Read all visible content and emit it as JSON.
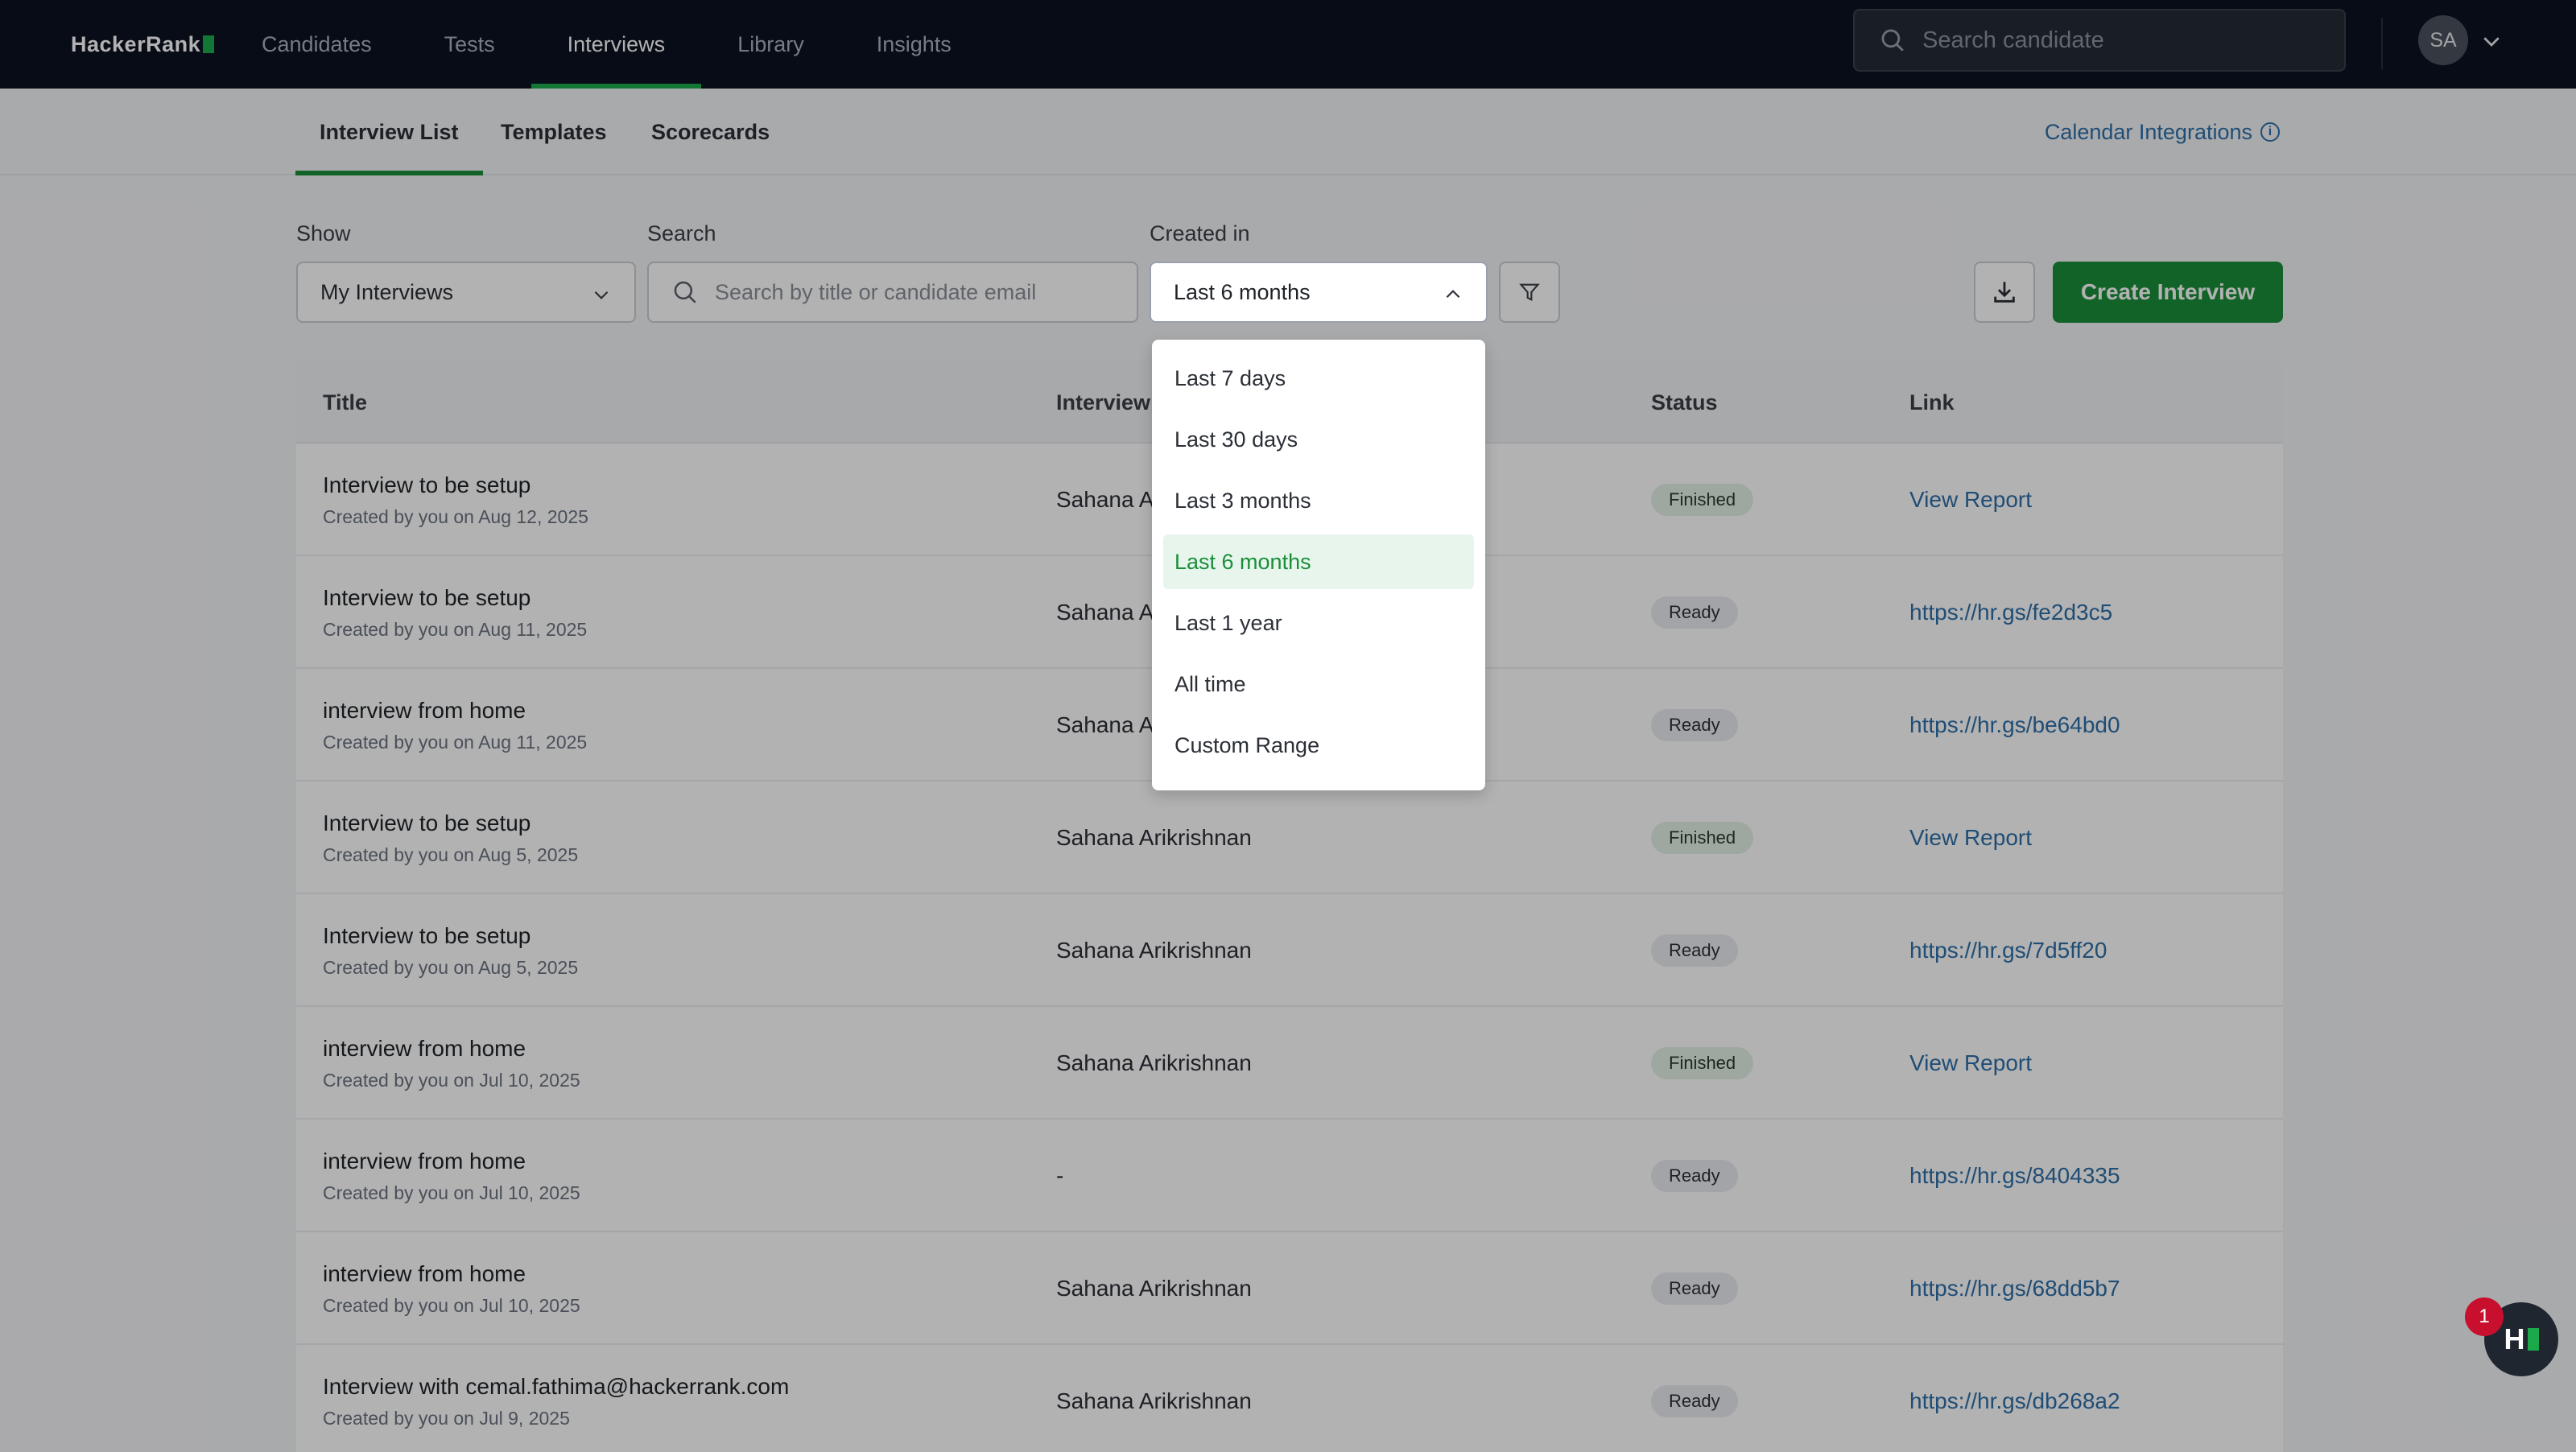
{
  "brand": {
    "name": "HackerRank"
  },
  "nav": {
    "items": [
      {
        "label": "Candidates"
      },
      {
        "label": "Tests"
      },
      {
        "label": "Interviews"
      },
      {
        "label": "Library"
      },
      {
        "label": "Insights"
      }
    ],
    "active": "Interviews",
    "search_placeholder": "Search candidate",
    "avatar_initials": "SA"
  },
  "subnav": {
    "tabs": [
      {
        "label": "Interview List"
      },
      {
        "label": "Templates"
      },
      {
        "label": "Scorecards"
      }
    ],
    "active": "Interview List",
    "calendar_link": "Calendar Integrations",
    "info_glyph": "i"
  },
  "filters": {
    "show_label": "Show",
    "show_value": "My Interviews",
    "search_label": "Search",
    "search_placeholder": "Search by title or candidate email",
    "created_label": "Created in",
    "created_value": "Last 6 months",
    "create_button": "Create Interview"
  },
  "dropdown": {
    "options": [
      {
        "label": "Last 7 days"
      },
      {
        "label": "Last 30 days"
      },
      {
        "label": "Last 3 months"
      },
      {
        "label": "Last 6 months"
      },
      {
        "label": "Last 1 year"
      },
      {
        "label": "All time"
      },
      {
        "label": "Custom Range"
      }
    ],
    "selected": "Last 6 months"
  },
  "table": {
    "headers": {
      "title": "Title",
      "interviewer": "Interview",
      "status": "Status",
      "link": "Link"
    },
    "rows": [
      {
        "title": "Interview to be setup",
        "sub": "Created by you on Aug 12, 2025",
        "interviewer": "Sahana Ar",
        "status": "Finished",
        "link": "View Report"
      },
      {
        "title": "Interview to be setup",
        "sub": "Created by you on Aug 11, 2025",
        "interviewer": "Sahana Ar",
        "status": "Ready",
        "link": "https://hr.gs/fe2d3c5"
      },
      {
        "title": "interview from home",
        "sub": "Created by you on Aug 11, 2025",
        "interviewer": "Sahana Ar",
        "status": "Ready",
        "link": "https://hr.gs/be64bd0"
      },
      {
        "title": "Interview to be setup",
        "sub": "Created by you on Aug 5, 2025",
        "interviewer": "Sahana Arikrishnan",
        "status": "Finished",
        "link": "View Report"
      },
      {
        "title": "Interview to be setup",
        "sub": "Created by you on Aug 5, 2025",
        "interviewer": "Sahana Arikrishnan",
        "status": "Ready",
        "link": "https://hr.gs/7d5ff20"
      },
      {
        "title": "interview from home",
        "sub": "Created by you on Jul 10, 2025",
        "interviewer": "Sahana Arikrishnan",
        "status": "Finished",
        "link": "View Report"
      },
      {
        "title": "interview from home",
        "sub": "Created by you on Jul 10, 2025",
        "interviewer": "-",
        "status": "Ready",
        "link": "https://hr.gs/8404335"
      },
      {
        "title": "interview from home",
        "sub": "Created by you on Jul 10, 2025",
        "interviewer": "Sahana Arikrishnan",
        "status": "Ready",
        "link": "https://hr.gs/68dd5b7"
      },
      {
        "title": "Interview with cemal.fathima@hackerrank.com",
        "sub": "Created by you on Jul 9, 2025",
        "interviewer": "Sahana Arikrishnan",
        "status": "Ready",
        "link": "https://hr.gs/db268a2"
      }
    ]
  },
  "chat": {
    "badge_count": "1",
    "label": "H"
  },
  "colors": {
    "accent": "#1a8f3a",
    "nav_bg": "#0b1220",
    "link": "#2f6fa8"
  }
}
